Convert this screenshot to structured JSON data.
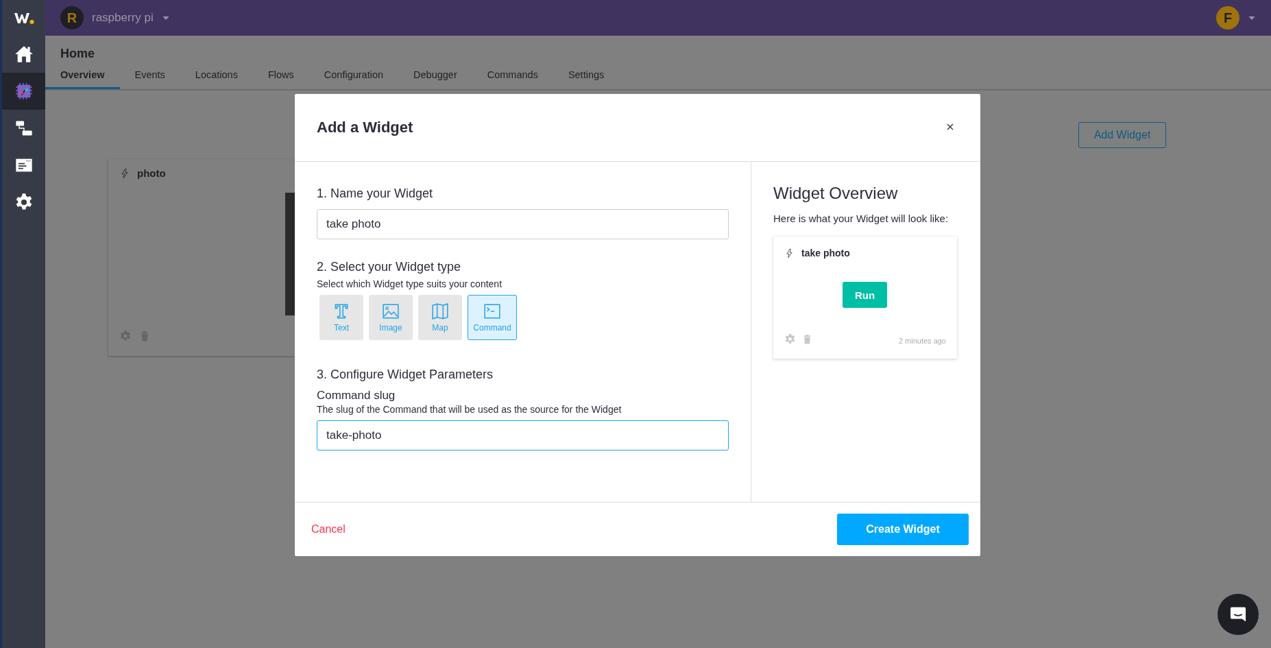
{
  "sidebar": {
    "items": [
      {
        "kind": "home",
        "selected": false
      },
      {
        "kind": "device",
        "selected": true
      },
      {
        "kind": "flow",
        "selected": false
      },
      {
        "kind": "dashboard",
        "selected": false
      },
      {
        "kind": "settings",
        "selected": false
      }
    ]
  },
  "top_bar": {
    "project": {
      "initial": "R",
      "name": "raspberry pi"
    },
    "user": {
      "initial": "F"
    }
  },
  "page": {
    "title": "Home",
    "tabs": [
      {
        "label": "Overview",
        "selected": true
      },
      {
        "label": "Events",
        "selected": false
      },
      {
        "label": "Locations",
        "selected": false
      },
      {
        "label": "Flows",
        "selected": false
      },
      {
        "label": "Configuration",
        "selected": false
      },
      {
        "label": "Debugger",
        "selected": false
      },
      {
        "label": "Commands",
        "selected": false
      },
      {
        "label": "Settings",
        "selected": false
      }
    ]
  },
  "add_widget_button": "Add Widget",
  "widgets": [
    {
      "title": "photo"
    }
  ],
  "modal": {
    "title": "Add a Widget",
    "step_1": {
      "heading": "1. Name your Widget",
      "value": "take photo"
    },
    "step_2": {
      "heading": "2. Select your Widget type",
      "hint": "Select which Widget type suits your content",
      "types": [
        {
          "kind": "text",
          "label": "Text",
          "selected": false
        },
        {
          "kind": "image",
          "label": "Image",
          "selected": false
        },
        {
          "kind": "map",
          "label": "Map",
          "selected": false
        },
        {
          "kind": "command",
          "label": "Command",
          "selected": true
        }
      ]
    },
    "step_3": {
      "heading": "3. Configure Widget Parameters",
      "field_label": "Command slug",
      "field_hint": "The slug of the Command that will be used as the source for the Widget",
      "value": "take-photo"
    },
    "overview": {
      "heading": "Widget Overview",
      "text": "Here is what your Widget will look like:",
      "preview": {
        "title": "take photo",
        "button": "Run",
        "time": "2 minutes ago"
      }
    },
    "cancel": "Cancel",
    "submit": "Create Widget"
  }
}
